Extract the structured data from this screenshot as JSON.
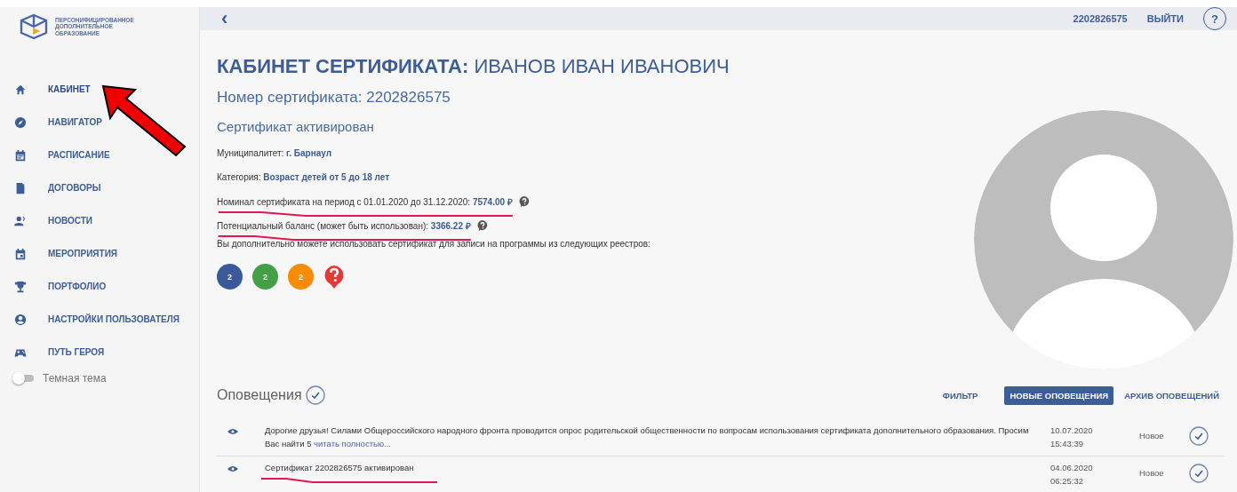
{
  "logo": {
    "lines": [
      "ПЕРСОНИФИЦИРОВАННОЕ",
      "ДОПОЛНИТЕЛЬНОЕ",
      "ОБРАЗОВАНИЕ"
    ]
  },
  "sidebar": {
    "items": [
      {
        "label": "КАБИНЕТ",
        "selected": true
      },
      {
        "label": "НАВИГАТОР",
        "selected": false
      },
      {
        "label": "РАСПИСАНИЕ",
        "selected": false
      },
      {
        "label": "ДОГОВОРЫ",
        "selected": false
      },
      {
        "label": "НОВОСТИ",
        "selected": false
      },
      {
        "label": "МЕРОПРИЯТИЯ",
        "selected": false
      },
      {
        "label": "ПОРТФОЛИО",
        "selected": false
      },
      {
        "label": "НАСТРОЙКИ ПОЛЬЗОВАТЕЛЯ",
        "selected": false
      },
      {
        "label": "ПУТЬ ГЕРОЯ",
        "selected": false
      }
    ],
    "dark_theme": {
      "label": "Темная тема",
      "on": false
    }
  },
  "topbar": {
    "back": "‹",
    "account": "2202826575",
    "logout": "ВЫЙТИ",
    "help": "?"
  },
  "title": {
    "prefix": "КАБИНЕТ СЕРТИФИКАТА:",
    "name": "ИВАНОВ ИВАН ИВАНОВИЧ"
  },
  "certificate_number": "Номер сертификата: 2202826575",
  "status": "Сертификат активирован",
  "fields": [
    {
      "label": "Муниципалитет:",
      "value": "г. Барнаул",
      "help": false,
      "underlined": false
    },
    {
      "label": "Категория:",
      "value": "Возраст детей от 5 до 18 лет",
      "help": false,
      "underlined": false
    },
    {
      "label": "Номинал сертификата на период с 01.01.2020 до 31.12.2020:",
      "value": "7574.00 ₽",
      "help": true,
      "underlined": true
    },
    {
      "label": "Потенциальный баланс (может быть использован):",
      "value": "3366.22 ₽",
      "help": true,
      "underlined": true
    }
  ],
  "registries_note": "Вы дополнительно можете использовать сертификат для записи на программы из следующих реестров:",
  "registries": [
    {
      "kind": "count",
      "label": "2",
      "color": "#3b5998"
    },
    {
      "kind": "count",
      "label": "2",
      "color": "#43a047"
    },
    {
      "kind": "count",
      "label": "2",
      "color": "#fb8c00"
    },
    {
      "kind": "unknown",
      "color": "#e53935"
    }
  ],
  "notifications": {
    "title": "Оповещения",
    "tabs": [
      {
        "label": "ФИЛЬТР",
        "selected": false
      },
      {
        "label": "НОВЫЕ ОПОВЕЩЕНИЯ",
        "selected": true
      },
      {
        "label": "АРХИВ ОПОВЕЩЕНИЙ",
        "selected": false
      }
    ],
    "rows": [
      {
        "text": "Дорогие друзья! Силами Общероссийского народного фронта проводится опрос родительской общественности по вопросам использования сертификата дополнительного образования. Просим Вас найти 5",
        "link": "читать полностью...",
        "date": "10.07.2020",
        "time": "15:43:39",
        "status": "Новое",
        "underlined": false
      },
      {
        "text": "Сертификат 2202826575 активирован",
        "date": "04.06.2020",
        "time": "06:25:32",
        "status": "Новое",
        "underlined": true
      }
    ]
  }
}
